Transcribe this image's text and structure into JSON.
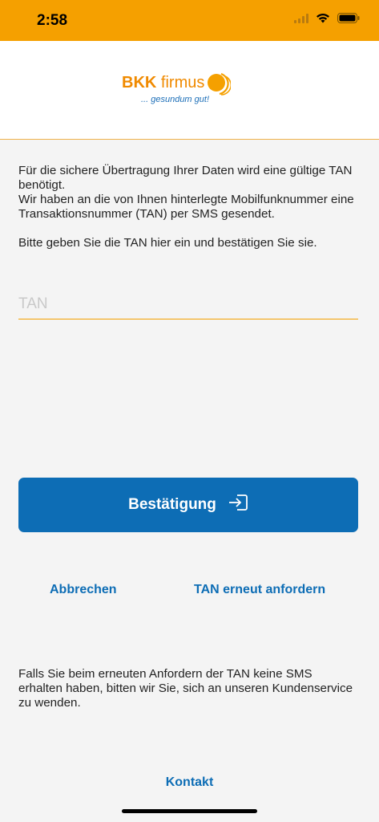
{
  "status_bar": {
    "time": "2:58",
    "icons": [
      "signal-icon",
      "wifi-icon",
      "battery-icon"
    ],
    "background": "#f5a000"
  },
  "header": {
    "logo_brand": "BKK",
    "logo_name": "firmus",
    "logo_slogan": "... gesundum gut!"
  },
  "intro": {
    "line1": "Für die sichere Übertragung Ihrer Daten wird eine gültige TAN benötigt.",
    "line2": "Wir haben an die von Ihnen hinterlegte Mobilfunknummer eine Transaktionsnummer (TAN) per SMS gesendet.",
    "line3": "Bitte geben Sie die TAN hier ein und bestätigen Sie sie."
  },
  "tan_input": {
    "placeholder": "TAN",
    "value": ""
  },
  "confirm_button": {
    "label": "Bestätigung",
    "icon": "login-icon",
    "color": "#0d6db5"
  },
  "actions": {
    "cancel_label": "Abbrechen",
    "resend_label": "TAN erneut anfordern"
  },
  "note": "Falls Sie beim erneuten Anfordern der TAN keine SMS erhalten haben, bitten wir Sie, sich an unseren Kundenservice zu wenden.",
  "contact_label": "Kontakt"
}
